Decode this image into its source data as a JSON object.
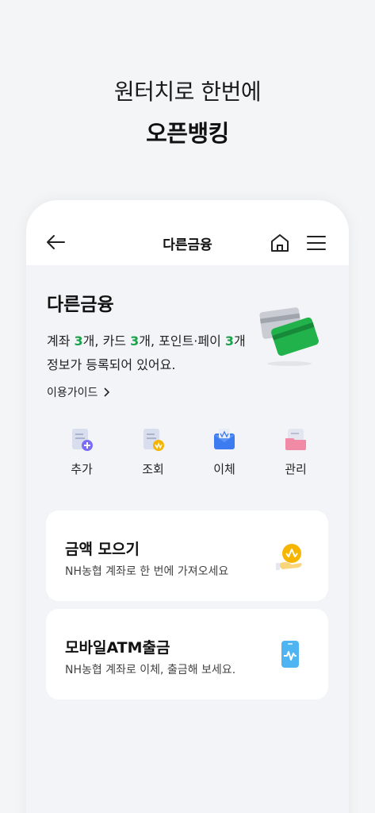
{
  "headline": {
    "line1": "원터치로 한번에",
    "line2": "오픈뱅킹"
  },
  "header": {
    "title": "다른금융",
    "icons": [
      "back-arrow-icon",
      "home-icon",
      "hamburger-menu-icon"
    ]
  },
  "section": {
    "title": "다른금융",
    "summary": {
      "accounts_label": "계좌 ",
      "accounts_count": "3",
      "accounts_suffix": "개, 카드 ",
      "cards_count": "3",
      "cards_suffix": "개, 포인트·페이 ",
      "points_count": "3",
      "points_suffix": "개",
      "line2": "정보가 등록되어 있어요."
    },
    "guide_link": "이용가이드"
  },
  "actions": [
    {
      "label": "추가",
      "icon": "document-add-icon",
      "color": "#7b6cf6"
    },
    {
      "label": "조회",
      "icon": "document-search-icon",
      "color": "#f5b400"
    },
    {
      "label": "이체",
      "icon": "transfer-icon",
      "color": "#3d7bf0"
    },
    {
      "label": "관리",
      "icon": "folder-manage-icon",
      "color": "#f08aa5"
    }
  ],
  "cards": [
    {
      "title": "금액 모으기",
      "subtitle": "NH농협 계좌로 한 번에 가져오세요",
      "icon": "coin-hand-icon"
    },
    {
      "title": "모바일ATM출금",
      "subtitle": "NH농협 계좌로 이체, 출금해 보세요.",
      "icon": "mobile-atm-icon"
    }
  ],
  "colors": {
    "accent_green": "#1aa34a",
    "background": "#f4f5f7",
    "card_bg": "#ffffff"
  }
}
